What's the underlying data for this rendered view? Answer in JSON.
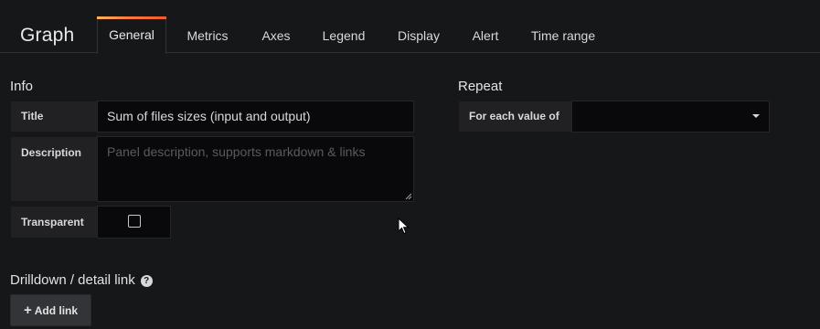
{
  "header": {
    "panel_type": "Graph",
    "tabs": [
      {
        "label": "General",
        "active": true
      },
      {
        "label": "Metrics",
        "active": false
      },
      {
        "label": "Axes",
        "active": false
      },
      {
        "label": "Legend",
        "active": false
      },
      {
        "label": "Display",
        "active": false
      },
      {
        "label": "Alert",
        "active": false
      },
      {
        "label": "Time range",
        "active": false
      }
    ]
  },
  "info": {
    "heading": "Info",
    "title_label": "Title",
    "title_value": "Sum of files sizes (input and output)",
    "description_label": "Description",
    "description_placeholder": "Panel description, supports markdown & links",
    "transparent_label": "Transparent",
    "transparent_checked": false
  },
  "repeat": {
    "heading": "Repeat",
    "for_each_label": "For each value of",
    "selected_value": ""
  },
  "drilldown": {
    "heading": "Drilldown / detail link",
    "help_icon": "question-circle-icon",
    "add_link_label": "Add link",
    "add_icon": "plus-icon"
  },
  "colors": {
    "background": "#161719",
    "label_bg": "#212124",
    "input_bg": "#09090b",
    "tab_accent": "#f05a28"
  }
}
